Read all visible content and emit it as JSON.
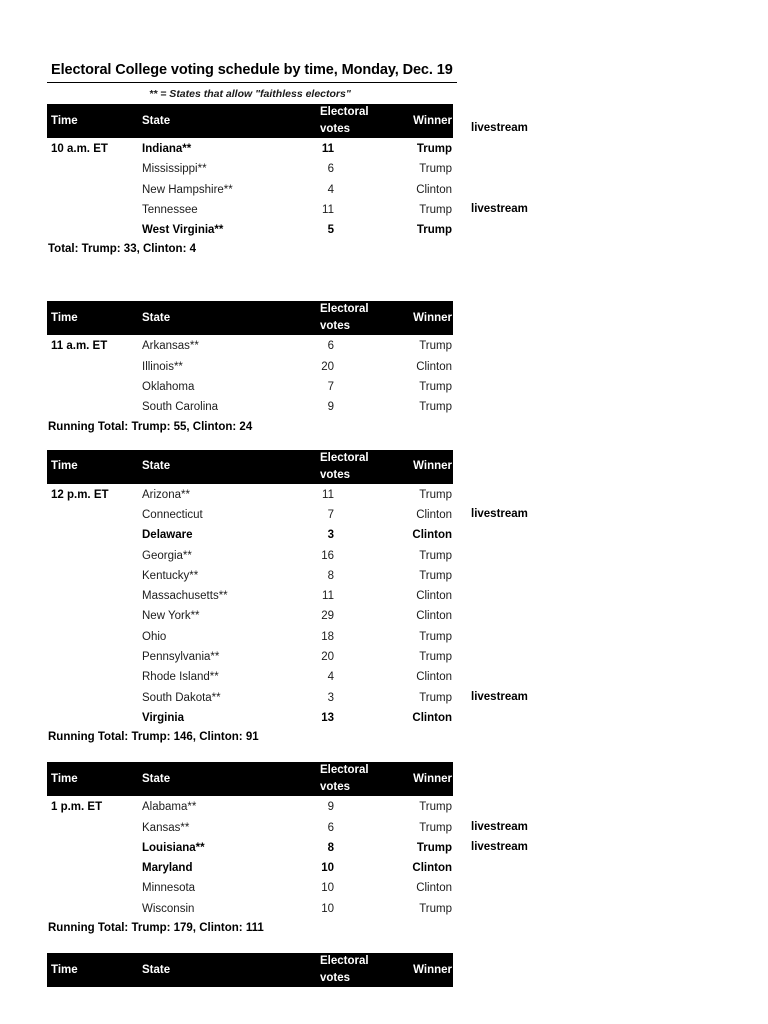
{
  "document": {
    "title": "Electoral College voting schedule by time, Monday, Dec. 19",
    "subtitle": "** = States that allow \"faithless electors\"",
    "livestream_label": "livestream"
  },
  "columns": {
    "time": "Time",
    "state": "State",
    "votes": "Electoral votes",
    "winner": "Winner"
  },
  "blocks": [
    {
      "time": "10 a.m. ET",
      "rows": [
        {
          "state": "Indiana**",
          "votes": "11",
          "winner": "Trump",
          "livestream": "livestream",
          "highlight": true
        },
        {
          "state": "Mississippi**",
          "votes": "6",
          "winner": "Trump",
          "livestream": "",
          "highlight": false
        },
        {
          "state": "New Hampshire**",
          "votes": "4",
          "winner": "Clinton",
          "livestream": "",
          "highlight": false
        },
        {
          "state": "Tennessee",
          "votes": "11",
          "winner": "Trump",
          "livestream": "",
          "highlight": false
        },
        {
          "state": "West Virginia**",
          "votes": "5",
          "winner": "Trump",
          "livestream": "livestream",
          "highlight": true
        }
      ],
      "total": "Total: Trump: 33, Clinton: 4"
    },
    {
      "time": "11 a.m. ET",
      "rows": [
        {
          "state": "Arkansas**",
          "votes": "6",
          "winner": "Trump",
          "livestream": "",
          "highlight": false
        },
        {
          "state": "Illinois**",
          "votes": "20",
          "winner": "Clinton",
          "livestream": "",
          "highlight": false
        },
        {
          "state": "Oklahoma",
          "votes": "7",
          "winner": "Trump",
          "livestream": "",
          "highlight": false
        },
        {
          "state": "South Carolina",
          "votes": "9",
          "winner": "Trump",
          "livestream": "",
          "highlight": false
        }
      ],
      "total": "Running Total: Trump: 55, Clinton: 24"
    },
    {
      "time": "12 p.m. ET",
      "rows": [
        {
          "state": "Arizona**",
          "votes": "11",
          "winner": "Trump",
          "livestream": "",
          "highlight": false
        },
        {
          "state": "Connecticut",
          "votes": "7",
          "winner": "Clinton",
          "livestream": "",
          "highlight": false
        },
        {
          "state": "Delaware",
          "votes": "3",
          "winner": "Clinton",
          "livestream": "livestream",
          "highlight": true
        },
        {
          "state": "Georgia**",
          "votes": "16",
          "winner": "Trump",
          "livestream": "",
          "highlight": false
        },
        {
          "state": "Kentucky**",
          "votes": "8",
          "winner": "Trump",
          "livestream": "",
          "highlight": false
        },
        {
          "state": "Massachusetts**",
          "votes": "11",
          "winner": "Clinton",
          "livestream": "",
          "highlight": false
        },
        {
          "state": "New York**",
          "votes": "29",
          "winner": "Clinton",
          "livestream": "",
          "highlight": false
        },
        {
          "state": "Ohio",
          "votes": "18",
          "winner": "Trump",
          "livestream": "",
          "highlight": false
        },
        {
          "state": "Pennsylvania**",
          "votes": "20",
          "winner": "Trump",
          "livestream": "",
          "highlight": false
        },
        {
          "state": "Rhode Island**",
          "votes": "4",
          "winner": "Clinton",
          "livestream": "",
          "highlight": false
        },
        {
          "state": "South Dakota**",
          "votes": "3",
          "winner": "Trump",
          "livestream": "",
          "highlight": false
        },
        {
          "state": "Virginia",
          "votes": "13",
          "winner": "Clinton",
          "livestream": "livestream",
          "highlight": true
        }
      ],
      "total": "Running Total: Trump: 146, Clinton: 91"
    },
    {
      "time": "1 p.m. ET",
      "rows": [
        {
          "state": "Alabama**",
          "votes": "9",
          "winner": "Trump",
          "livestream": "",
          "highlight": false
        },
        {
          "state": "Kansas**",
          "votes": "6",
          "winner": "Trump",
          "livestream": "",
          "highlight": false
        },
        {
          "state": "Louisiana**",
          "votes": "8",
          "winner": "Trump",
          "livestream": "livestream",
          "highlight": true
        },
        {
          "state": "Maryland",
          "votes": "10",
          "winner": "Clinton",
          "livestream": "livestream",
          "highlight": true
        },
        {
          "state": "Minnesota",
          "votes": "10",
          "winner": "Clinton",
          "livestream": "",
          "highlight": false
        },
        {
          "state": "Wisconsin",
          "votes": "10",
          "winner": "Trump",
          "livestream": "",
          "highlight": false
        }
      ],
      "total": "Running Total: Trump: 179, Clinton: 111"
    },
    {
      "time": "",
      "rows": [],
      "total": ""
    }
  ]
}
